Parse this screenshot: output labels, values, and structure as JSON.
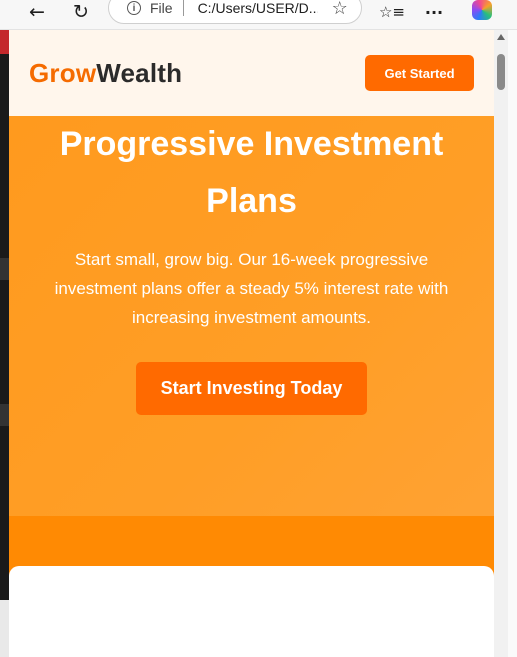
{
  "browser": {
    "back_icon": "←",
    "refresh_icon": "↻",
    "info_icon": "i",
    "file_label": "File",
    "url": "C:/Users/USER/D...",
    "star_icon": "☆",
    "favorites_icon": "☆≡",
    "more_icon": "···"
  },
  "header": {
    "brand_part1": "Grow",
    "brand_part2": "Wealth",
    "cta_label": "Get Started"
  },
  "hero": {
    "title_line1": "Progressive Investment",
    "title_line2": "Plans",
    "subtitle": "Start small, grow big. Our 16-week progressive investment plans offer a steady 5% interest rate with increasing investment amounts.",
    "cta_label": "Start Investing Today"
  },
  "colors": {
    "brand_orange": "#f56b00",
    "button_orange": "#ff6a00",
    "hero_orange": "#ff9b1f",
    "nav_background": "#fff6ec"
  }
}
